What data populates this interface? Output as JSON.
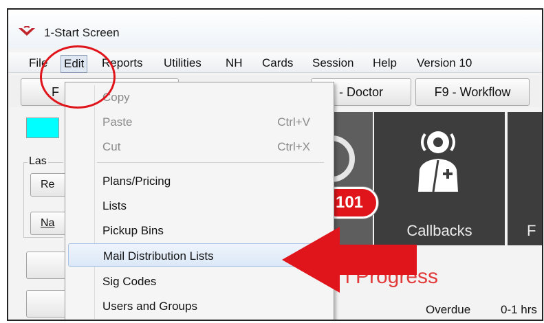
{
  "window": {
    "title": "1-Start Screen",
    "icon": "app-logo-icon"
  },
  "menubar": {
    "items": [
      {
        "label": "File"
      },
      {
        "label": "Edit"
      },
      {
        "label": "Reports"
      },
      {
        "label": "Utilities"
      },
      {
        "label": "NH"
      },
      {
        "label": "Cards"
      },
      {
        "label": "Session"
      },
      {
        "label": "Help"
      },
      {
        "label": "Version 10"
      }
    ],
    "active": "Edit"
  },
  "toolbar": {
    "buttons": [
      {
        "label": "F"
      },
      {
        "label": "- Doctor"
      },
      {
        "label": "F9 - Workflow"
      }
    ]
  },
  "left_panel": {
    "group_label": "Las",
    "buttons": [
      {
        "label": "Re"
      },
      {
        "label": "Na"
      }
    ],
    "cyan_indicator_color": "#00ffff"
  },
  "tiles": [
    {
      "label": "",
      "badge": "101"
    },
    {
      "label": "Callbacks",
      "icon": "doctor-icon"
    },
    {
      "label": "F"
    }
  ],
  "status": {
    "progress_text": "l Progress",
    "overdue_label": "Overdue",
    "range_label": "0-1 hrs"
  },
  "edit_menu": {
    "items": [
      {
        "label": "Copy",
        "shortcut": "",
        "enabled": false
      },
      {
        "label": "Paste",
        "shortcut": "Ctrl+V",
        "enabled": false
      },
      {
        "label": "Cut",
        "shortcut": "Ctrl+X",
        "enabled": false
      },
      {
        "label": "Plans/Pricing",
        "shortcut": "",
        "enabled": true
      },
      {
        "label": "Lists",
        "shortcut": "",
        "enabled": true
      },
      {
        "label": "Pickup Bins",
        "shortcut": "",
        "enabled": true
      },
      {
        "label": "Mail Distribution Lists",
        "shortcut": "",
        "enabled": true,
        "highlighted": true
      },
      {
        "label": "Sig Codes",
        "shortcut": "",
        "enabled": true
      },
      {
        "label": "Users and Groups",
        "shortcut": "",
        "enabled": true
      }
    ]
  },
  "colors": {
    "annotation_red": "#e0141b",
    "tile_dark": "#3d3d3d",
    "progress_red": "#e23a3a"
  }
}
